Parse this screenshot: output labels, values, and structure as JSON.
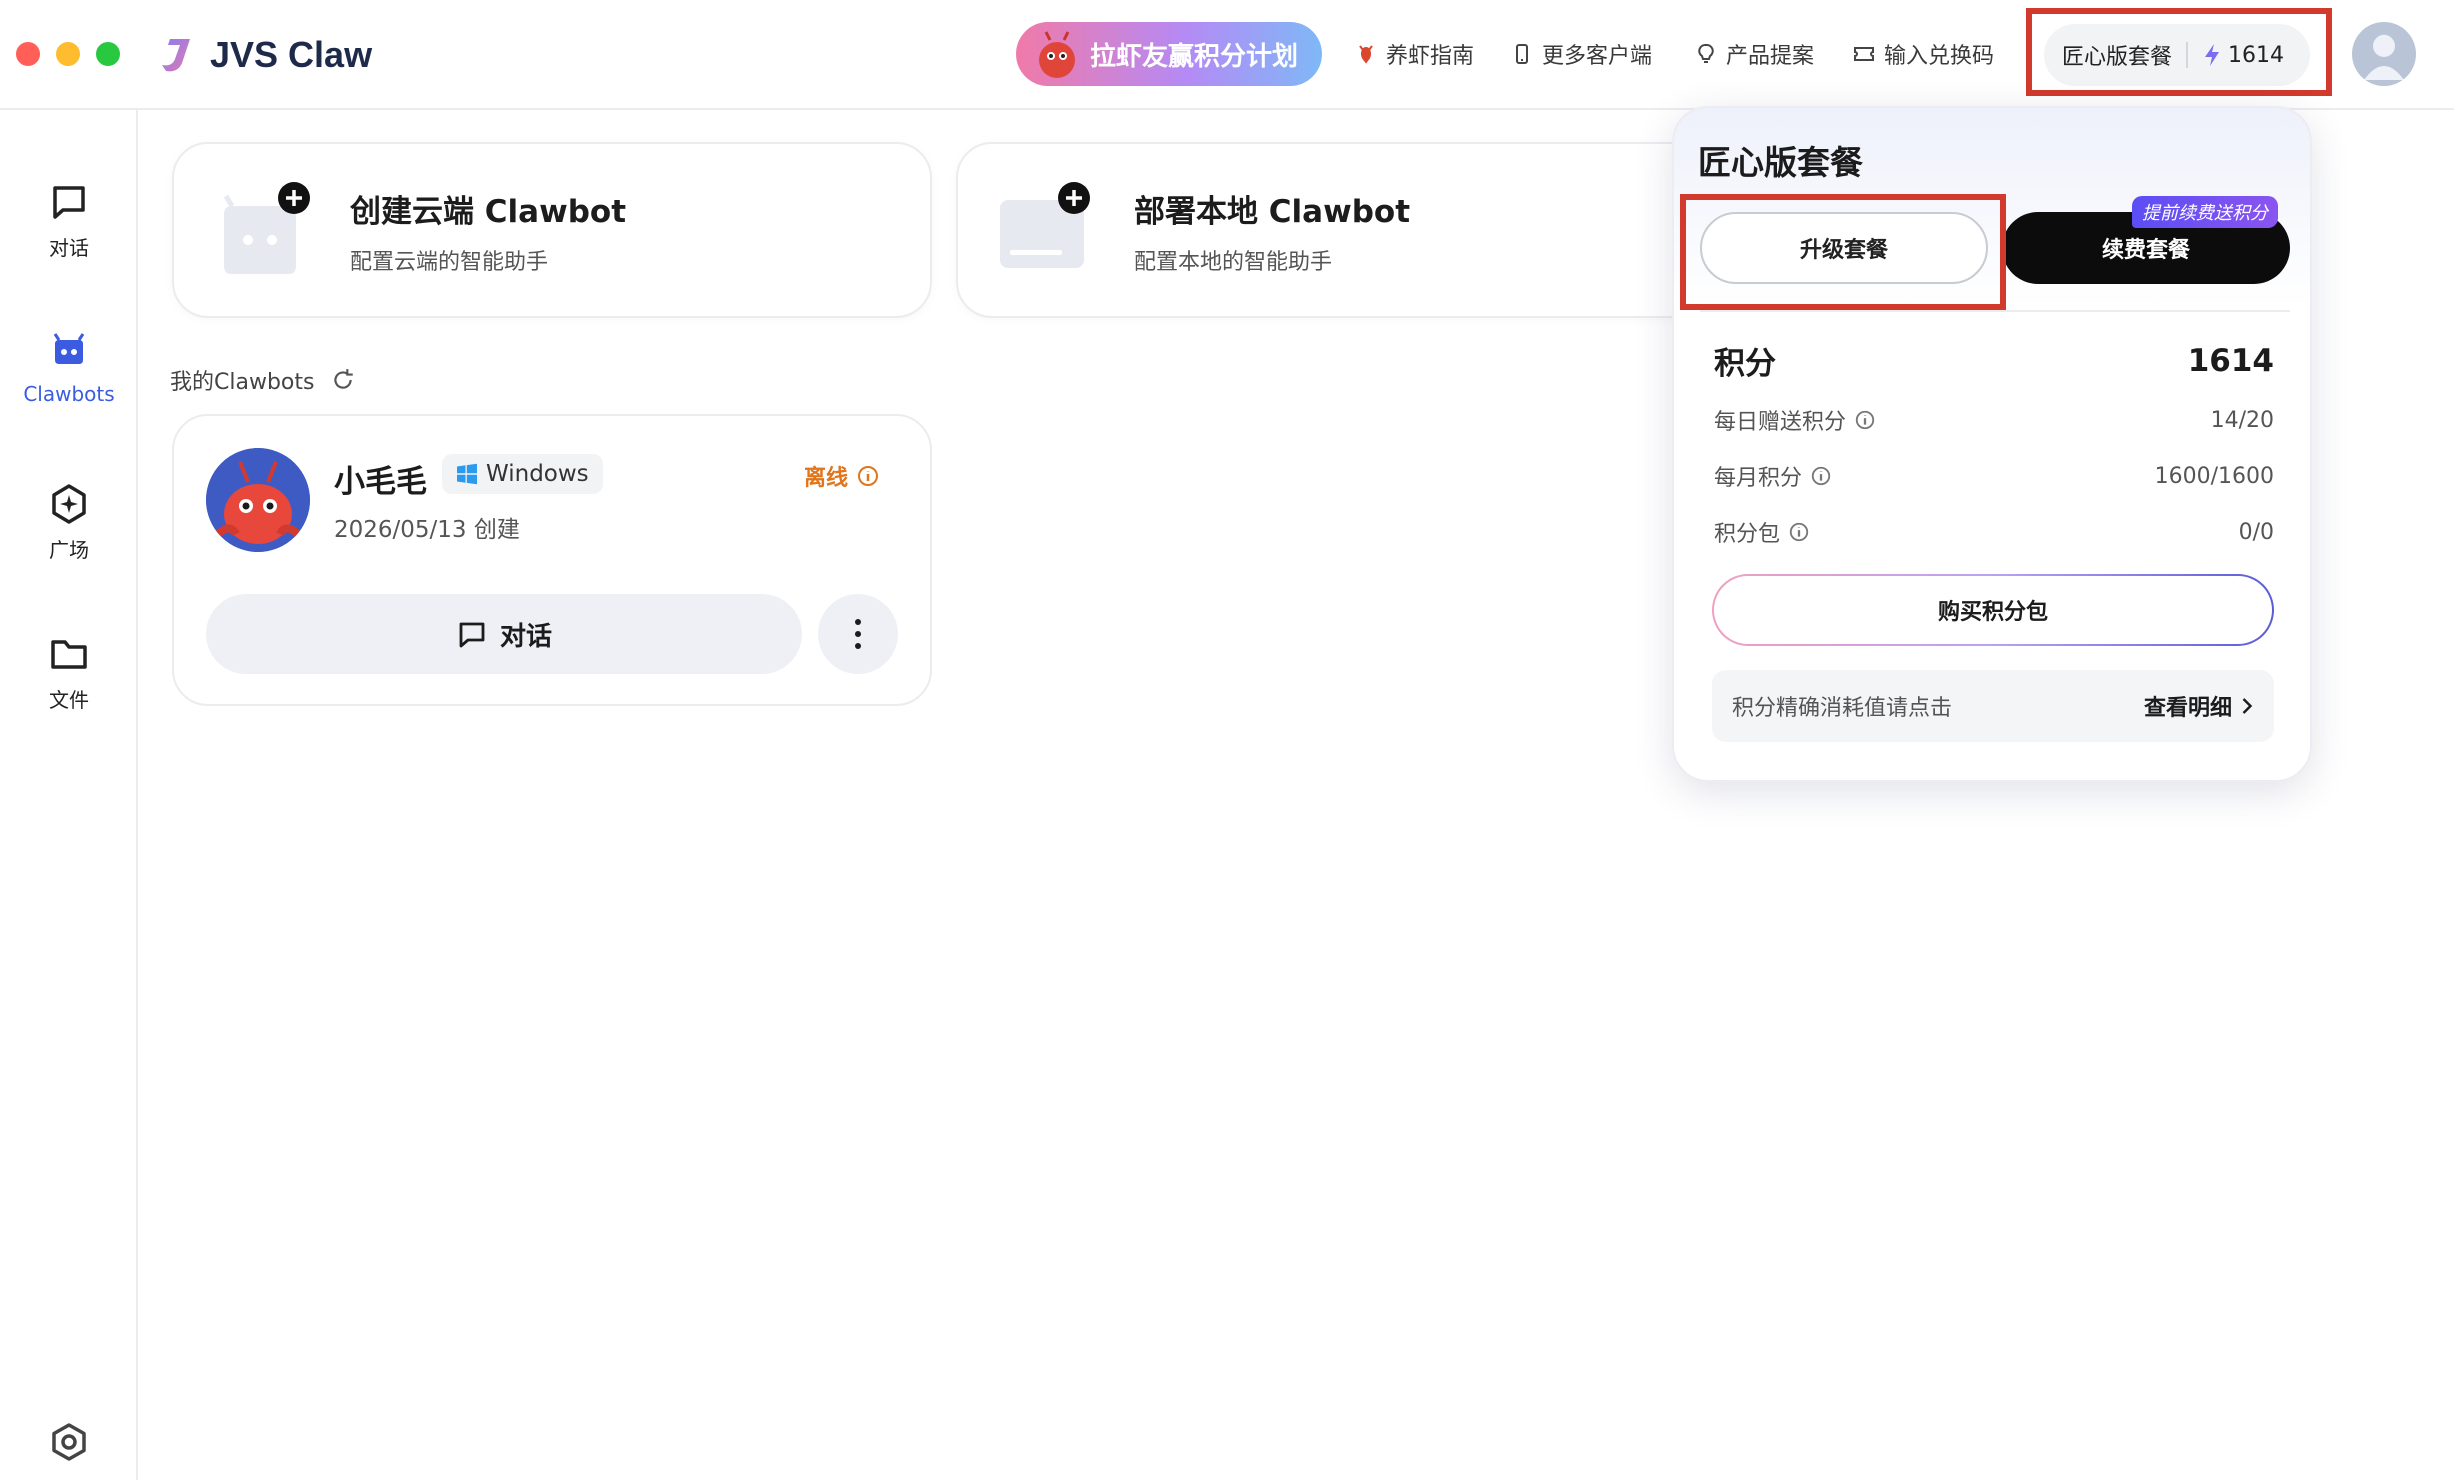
{
  "app": {
    "name": "JVS Claw"
  },
  "header": {
    "promo_label": "拉虾友赢积分计划",
    "nav": [
      {
        "id": "guide",
        "label": "养虾指南",
        "icon": "lobster-icon"
      },
      {
        "id": "clients",
        "label": "更多客户端",
        "icon": "phone-icon"
      },
      {
        "id": "proposal",
        "label": "产品提案",
        "icon": "lightbulb-icon"
      },
      {
        "id": "redeem",
        "label": "输入兑换码",
        "icon": "ticket-icon"
      }
    ],
    "plan_name": "匠心版套餐",
    "points": "1614"
  },
  "sidebar": {
    "items": [
      {
        "label": "对话",
        "icon": "chat-icon"
      },
      {
        "label": "Clawbots",
        "icon": "robot-icon",
        "active": true
      },
      {
        "label": "广场",
        "icon": "plaza-icon"
      },
      {
        "label": "文件",
        "icon": "folder-icon"
      }
    ],
    "settings_icon": "settings-icon"
  },
  "create_cards": [
    {
      "title": "创建云端 Clawbot",
      "subtitle": "配置云端的智能助手"
    },
    {
      "title": "部署本地 Clawbot",
      "subtitle": "配置本地的智能助手"
    }
  ],
  "my_bots": {
    "label": "我的Clawbots",
    "bots": [
      {
        "name": "小毛毛",
        "os": "Windows",
        "created": "2026/05/13 创建",
        "status": "离线",
        "chat_label": "对话"
      }
    ]
  },
  "plan_popup": {
    "title": "匠心版套餐",
    "upgrade_label": "升级套餐",
    "renew_label": "续费套餐",
    "renew_tag": "提前续费送积分",
    "points_label": "积分",
    "points_value": "1614",
    "rows": [
      {
        "label": "每日赠送积分",
        "value": "14/20"
      },
      {
        "label": "每月积分",
        "value": "1600/1600"
      },
      {
        "label": "积分包",
        "value": "0/0"
      }
    ],
    "buy_label": "购买积分包",
    "consume_label": "积分精确消耗值请点击",
    "detail_label": "查看明细"
  },
  "colors": {
    "accent": "#3b5ce0",
    "highlight_box": "#d13a2c",
    "offline": "#e0751c"
  }
}
